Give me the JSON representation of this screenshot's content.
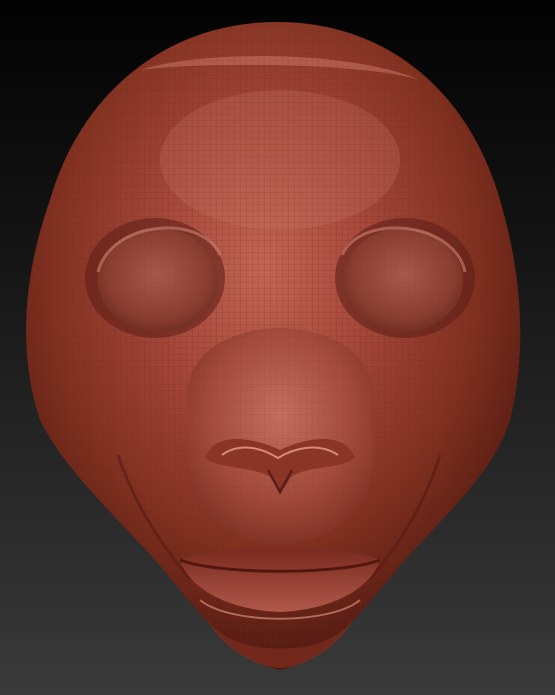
{
  "scene": {
    "subject": "sculpted-head-model",
    "colors": {
      "background_top": "#020202",
      "background_bottom": "#3a3a3a",
      "clay_base": "#9a3b2c",
      "clay_highlight": "#c46a58",
      "clay_shadow": "#5a1e15",
      "wire_lines": "#7a2e22"
    }
  }
}
